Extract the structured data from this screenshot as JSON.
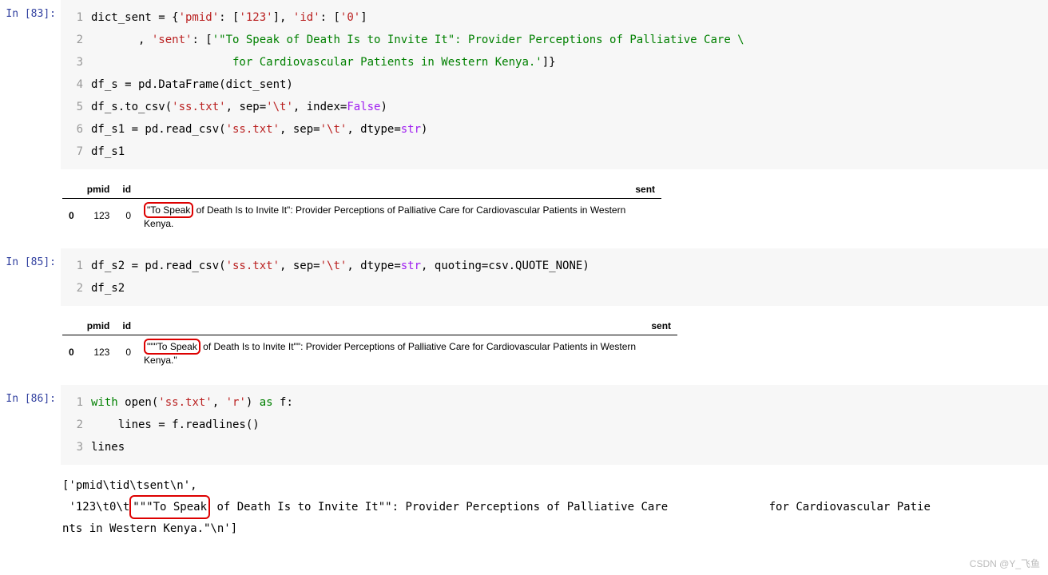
{
  "cells": {
    "p0": "In  [83]:",
    "p1": "In  [85]:",
    "p2": "In  [86]:"
  },
  "c0": {
    "l1a": "dict_sent = {",
    "l1b": "'pmid'",
    "l1c": ": [",
    "l1d": "'123'",
    "l1e": "], ",
    "l1f": "'id'",
    "l1g": ": [",
    "l1h": "'0'",
    "l1i": "]",
    "l2a": "       , ",
    "l2b": "'sent'",
    "l2c": ": [",
    "l2d": "'\"To Speak of Death Is to Invite It\": Provider Perceptions of Palliative Care \\",
    "l3a": "                     for Cardiovascular Patients in Western Kenya.'",
    "l3b": "]}",
    "l4a": "df_s = pd.DataFrame(dict_sent)",
    "l5a": "df_s.to_csv(",
    "l5b": "'ss.txt'",
    "l5c": ", sep=",
    "l5d": "'\\t'",
    "l5e": ", index=",
    "l5f": "False",
    "l5g": ")",
    "l6a": "df_s1 = pd.read_csv(",
    "l6b": "'ss.txt'",
    "l6c": ", sep=",
    "l6d": "'\\t'",
    "l6e": ", dtype=",
    "l6f": "str",
    "l6g": ")",
    "l7a": "df_s1"
  },
  "c1": {
    "l1a": "df_s2 = pd.read_csv(",
    "l1b": "'ss.txt'",
    "l1c": ", sep=",
    "l1d": "'\\t'",
    "l1e": ", dtype=",
    "l1f": "str",
    "l1g": ", quoting=csv.QUOTE_NONE)",
    "l2a": "df_s2"
  },
  "c2": {
    "l1a": "with",
    "l1b": " open(",
    "l1c": "'ss.txt'",
    "l1d": ", ",
    "l1e": "'r'",
    "l1f": ") ",
    "l1g": "as",
    "l1h": " f:",
    "l2a": "    lines = f.readlines()",
    "l3a": "lines"
  },
  "table": {
    "h_pmid": "pmid",
    "h_id": "id",
    "h_sent": "sent",
    "idx0": "0",
    "pmid0": "123",
    "id0": "0",
    "sent1_hl": "\"To Speak",
    "sent1_rest": " of Death Is to Invite It\": Provider Perceptions of Palliative Care for Cardiovascular Patients in Western Kenya.",
    "sent2_hl": "\"\"\"To Speak",
    "sent2_rest": " of Death Is to Invite It\"\": Provider Perceptions of Palliative Care for Cardiovascular Patients in Western Kenya.\""
  },
  "lines_out": {
    "p1": "['pmid\\tid\\tsent\\n',",
    "p2a": " '123\\t0\\t",
    "p2hl": "\"\"\"To Speak",
    "p2b": " of Death Is to Invite It\"\": Provider Perceptions of Palliative Care               for Cardiovascular Patie",
    "p3": "nts in Western Kenya.\"\\n']"
  },
  "watermark": "CSDN @Y_飞鱼"
}
